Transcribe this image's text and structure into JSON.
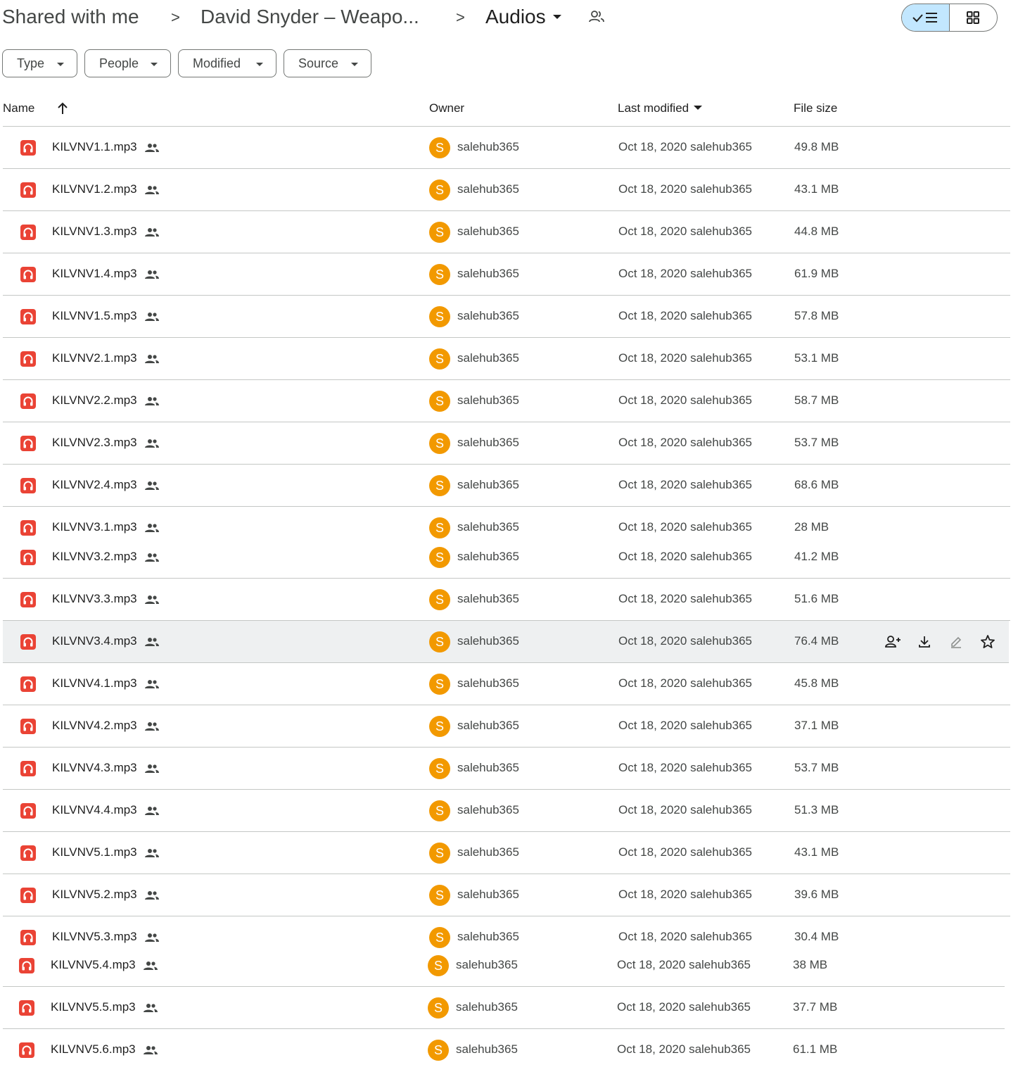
{
  "breadcrumb": {
    "items": [
      "Shared with me",
      "David Snyder – Weapo...",
      "Audios"
    ],
    "separator": ">"
  },
  "filters": [
    "Type",
    "People",
    "Modified",
    "Source"
  ],
  "columns": {
    "name": "Name",
    "owner": "Owner",
    "last_modified": "Last modified",
    "file_size": "File size"
  },
  "colors": {
    "audio_icon": "#ea4335",
    "avatar": "#f29900",
    "view_active": "#c2e7ff",
    "row_hover": "#eef0f1"
  },
  "rows": [
    {
      "name": "KILVNV1.1.mp3",
      "avatar": "S",
      "owner": "salehub365",
      "modified": "Oct 18, 2020 salehub365",
      "size": "49.8 MB"
    },
    {
      "name": "KILVNV1.2.mp3",
      "avatar": "S",
      "owner": "salehub365",
      "modified": "Oct 18, 2020 salehub365",
      "size": "43.1 MB"
    },
    {
      "name": "KILVNV1.3.mp3",
      "avatar": "S",
      "owner": "salehub365",
      "modified": "Oct 18, 2020 salehub365",
      "size": "44.8 MB"
    },
    {
      "name": "KILVNV1.4.mp3",
      "avatar": "S",
      "owner": "salehub365",
      "modified": "Oct 18, 2020 salehub365",
      "size": "61.9 MB"
    },
    {
      "name": "KILVNV1.5.mp3",
      "avatar": "S",
      "owner": "salehub365",
      "modified": "Oct 18, 2020 salehub365",
      "size": "57.8 MB"
    },
    {
      "name": "KILVNV2.1.mp3",
      "avatar": "S",
      "owner": "salehub365",
      "modified": "Oct 18, 2020 salehub365",
      "size": "53.1 MB"
    },
    {
      "name": "KILVNV2.2.mp3",
      "avatar": "S",
      "owner": "salehub365",
      "modified": "Oct 18, 2020 salehub365",
      "size": "58.7 MB"
    },
    {
      "name": "KILVNV2.3.mp3",
      "avatar": "S",
      "owner": "salehub365",
      "modified": "Oct 18, 2020 salehub365",
      "size": "53.7 MB"
    },
    {
      "name": "KILVNV2.4.mp3",
      "avatar": "S",
      "owner": "salehub365",
      "modified": "Oct 18, 2020 salehub365",
      "size": "68.6 MB"
    },
    {
      "name": "KILVNV3.1.mp3",
      "avatar": "S",
      "owner": "salehub365",
      "modified": "Oct 18, 2020 salehub365",
      "size": "28 MB"
    },
    {
      "name": "KILVNV3.2.mp3",
      "avatar": "S",
      "owner": "salehub365",
      "modified": "Oct 18, 2020 salehub365",
      "size": "41.2 MB"
    },
    {
      "name": "KILVNV3.3.mp3",
      "avatar": "S",
      "owner": "salehub365",
      "modified": "Oct 18, 2020 salehub365",
      "size": "51.6 MB"
    },
    {
      "name": "KILVNV3.4.mp3",
      "avatar": "S",
      "owner": "salehub365",
      "modified": "Oct 18, 2020 salehub365",
      "size": "76.4 MB"
    },
    {
      "name": "KILVNV4.1.mp3",
      "avatar": "S",
      "owner": "salehub365",
      "modified": "Oct 18, 2020 salehub365",
      "size": "45.8 MB"
    },
    {
      "name": "KILVNV4.2.mp3",
      "avatar": "S",
      "owner": "salehub365",
      "modified": "Oct 18, 2020 salehub365",
      "size": "37.1 MB"
    },
    {
      "name": "KILVNV4.3.mp3",
      "avatar": "S",
      "owner": "salehub365",
      "modified": "Oct 18, 2020 salehub365",
      "size": "53.7 MB"
    },
    {
      "name": "KILVNV4.4.mp3",
      "avatar": "S",
      "owner": "salehub365",
      "modified": "Oct 18, 2020 salehub365",
      "size": "51.3 MB"
    },
    {
      "name": "KILVNV5.1.mp3",
      "avatar": "S",
      "owner": "salehub365",
      "modified": "Oct 18, 2020 salehub365",
      "size": "43.1 MB"
    },
    {
      "name": "KILVNV5.2.mp3",
      "avatar": "S",
      "owner": "salehub365",
      "modified": "Oct 18, 2020 salehub365",
      "size": "39.6 MB"
    },
    {
      "name": "KILVNV5.3.mp3",
      "avatar": "S",
      "owner": "salehub365",
      "modified": "Oct 18, 2020 salehub365",
      "size": "30.4 MB"
    },
    {
      "name": "KILVNV5.4.mp3",
      "avatar": "S",
      "owner": "salehub365",
      "modified": "Oct 18, 2020 salehub365",
      "size": "38 MB"
    },
    {
      "name": "KILVNV5.5.mp3",
      "avatar": "S",
      "owner": "salehub365",
      "modified": "Oct 18, 2020 salehub365",
      "size": "37.7 MB"
    },
    {
      "name": "KILVNV5.6.mp3",
      "avatar": "S",
      "owner": "salehub365",
      "modified": "Oct 18, 2020 salehub365",
      "size": "61.1 MB"
    }
  ]
}
